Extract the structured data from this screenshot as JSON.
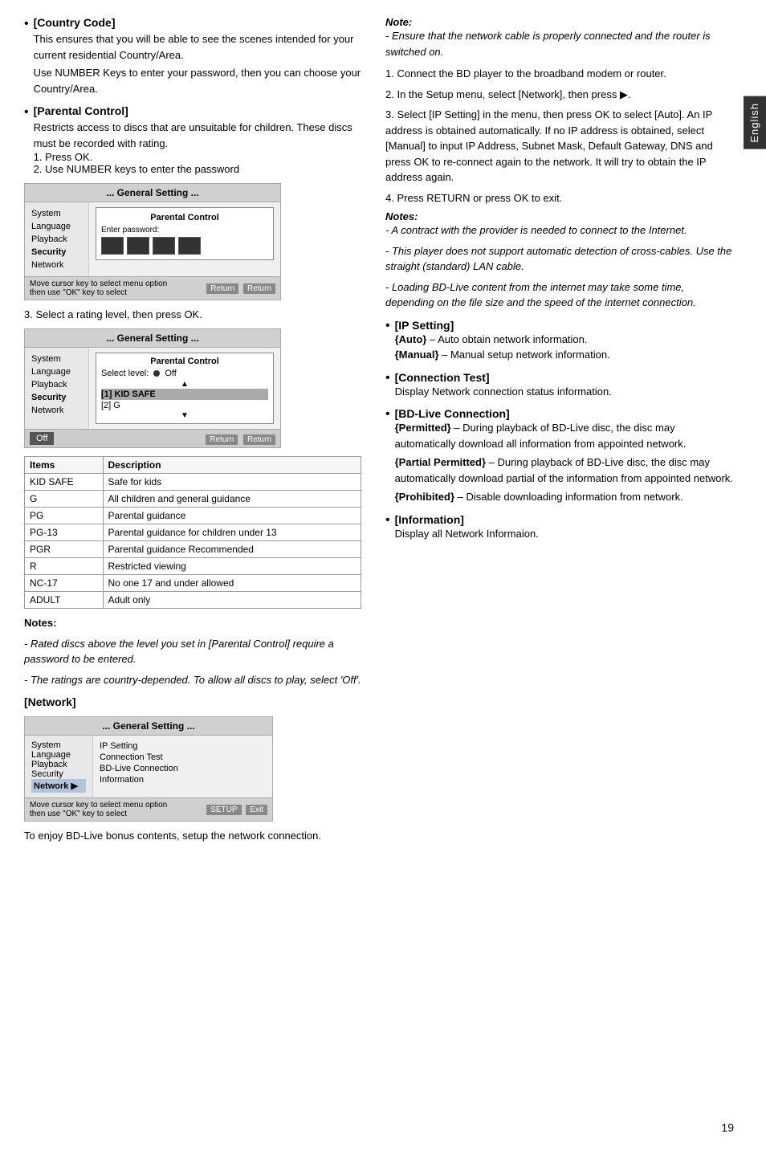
{
  "sidebar": {
    "label": "English"
  },
  "left": {
    "country_code": {
      "title": "[Country Code]",
      "text1": "This ensures that you will be able to see the scenes intended for your current residential Country/Area.",
      "text2": "Use NUMBER Keys to enter your password, then you can choose your Country/Area."
    },
    "parental_control": {
      "title": "[Parental Control]",
      "text1": "Restricts access to discs that are unsuitable for children. These discs must be recorded with rating.",
      "step1": "1. Press OK.",
      "step2": "2. Use NUMBER keys to enter the password"
    },
    "dialog1": {
      "title": "... General Setting ...",
      "menu_items": [
        "System",
        "Language",
        "Playback",
        "Security",
        "Network"
      ],
      "active_menu": "Security",
      "parental_title": "Parental Control",
      "enter_password": "Enter password:",
      "footer_text1": "Move cursor key to select menu option",
      "footer_text2": "then use \"OK\" key to select",
      "btn_return": "Return",
      "btn_return2": "Return"
    },
    "step3_text": "3. Select a rating level, then press OK.",
    "dialog2": {
      "title": "... General Setting ...",
      "menu_items": [
        "System",
        "Language",
        "Playback",
        "Security",
        "Network"
      ],
      "active_menu": "Security",
      "parental_title": "Parental Control",
      "select_level_label": "Select level:",
      "radio_label": "Off",
      "level1": "[1] KID SAFE",
      "level2": "[2] G",
      "off_label": "Off",
      "btn_return": "Return",
      "btn_return2": "Return"
    },
    "table": {
      "col1": "Items",
      "col2": "Description",
      "rows": [
        {
          "item": "KID SAFE",
          "desc": "Safe for kids"
        },
        {
          "item": "G",
          "desc": "All children and general guidance"
        },
        {
          "item": "PG",
          "desc": "Parental guidance"
        },
        {
          "item": "PG-13",
          "desc": "Parental guidance for children under 13"
        },
        {
          "item": "PGR",
          "desc": "Parental guidance Recommended"
        },
        {
          "item": "R",
          "desc": "Restricted viewing"
        },
        {
          "item": "NC-17",
          "desc": "No one 17 and under allowed"
        },
        {
          "item": "ADULT",
          "desc": "Adult only"
        }
      ]
    },
    "notes_title": "Notes:",
    "note1": "- Rated discs above the level you set in [Parental Control] require a password to be entered.",
    "note2": "- The ratings are country-depended. To allow all discs to play, select 'Off'.",
    "network_title": "[Network]",
    "network_dialog": {
      "title": "... General Setting ...",
      "menu_items": [
        "System",
        "Language",
        "Playback",
        "Security",
        "Network"
      ],
      "active_menu": "Network",
      "options": [
        "IP Setting",
        "Connection Test",
        "BD-Live Connection",
        "Information"
      ],
      "footer_text1": "Move cursor key to select menu option",
      "footer_text2": "then use \"OK\" key to select",
      "btn_setup": "SETUP",
      "btn_exit": "Exit"
    },
    "network_text": "To enjoy BD-Live bonus contents, setup the network connection."
  },
  "right": {
    "note_label": "Note:",
    "note_intro1": "- Ensure that the network cable is properly connected and the router is switched on.",
    "steps": [
      "1. Connect the BD player to the broadband modem or router.",
      "2. In the Setup menu, select [Network], then press ▶.",
      "3. Select [IP Setting] in the menu, then press OK to select [Auto]. An IP address is obtained automatically. If no IP address is obtained, select [Manual] to input IP Address, Subnet Mask, Default Gateway, DNS and press OK to re-connect again to the network. It will try to obtain the IP address again.",
      "4. Press RETURN or press OK to exit."
    ],
    "notes_title": "Notes:",
    "note_a": "- A contract with the provider is needed to connect to the Internet.",
    "note_b": "- This player does not support automatic detection of cross-cables. Use the straight (standard) LAN cable.",
    "note_c": "- Loading BD-Live content from the internet may take some time, depending on the file size and the speed of the internet connection.",
    "bullets": [
      {
        "title": "[IP Setting]",
        "items": [
          "{Auto} – Auto obtain network information.",
          "{Manual} – Manual setup network information."
        ]
      },
      {
        "title": "[Connection Test]",
        "items": [
          "Display Network connection status information."
        ]
      },
      {
        "title": "[BD-Live Connection]",
        "items": [
          "{Permitted} – During playback of BD-Live disc, the disc may automatically download all information from appointed network.",
          "{Partial Permitted} – During playback of BD-Live disc, the disc may automatically download partial of the information from appointed network.",
          "{Prohibited} – Disable downloading information from network."
        ]
      },
      {
        "title": "[Information]",
        "items": [
          "Display all Network Informaion."
        ]
      }
    ]
  },
  "page_number": "19"
}
